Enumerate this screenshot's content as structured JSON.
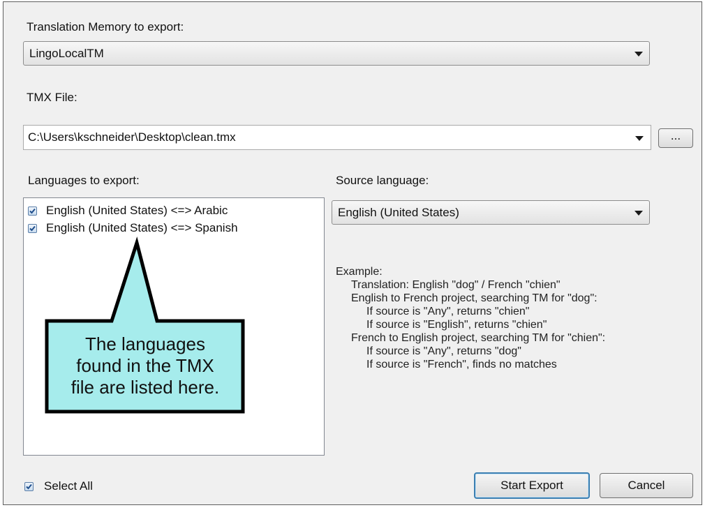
{
  "tm_export": {
    "label": "Translation Memory to export:",
    "selected": "LingoLocalTM"
  },
  "tmx_file": {
    "label": "TMX File:",
    "value": "C:\\Users\\kschneider\\Desktop\\clean.tmx",
    "browse_label": "..."
  },
  "languages": {
    "label": "Languages to export:",
    "items": [
      {
        "label": "English (United States) <=> Arabic",
        "checked": true
      },
      {
        "label": "English (United States) <=> Spanish",
        "checked": true
      }
    ]
  },
  "source_language": {
    "label": "Source language:",
    "selected": "English (United States)"
  },
  "example": {
    "heading": "Example:",
    "lines": [
      "Translation: English \"dog\" / French \"chien\"",
      "English to French project, searching TM for \"dog\":",
      "If source is \"Any\", returns \"chien\"",
      "If source is \"English\", returns \"chien\"",
      "French to English project, searching TM for \"chien\":",
      "If source is \"Any\", returns \"dog\"",
      "If source is \"French\", finds no matches"
    ]
  },
  "callout": {
    "lines": [
      "The languages",
      "found in the TMX",
      "file are listed here."
    ],
    "fill_color": "#a6ecec"
  },
  "select_all": {
    "label": "Select All",
    "checked": true
  },
  "buttons": {
    "start_export": "Start Export",
    "cancel": "Cancel"
  }
}
